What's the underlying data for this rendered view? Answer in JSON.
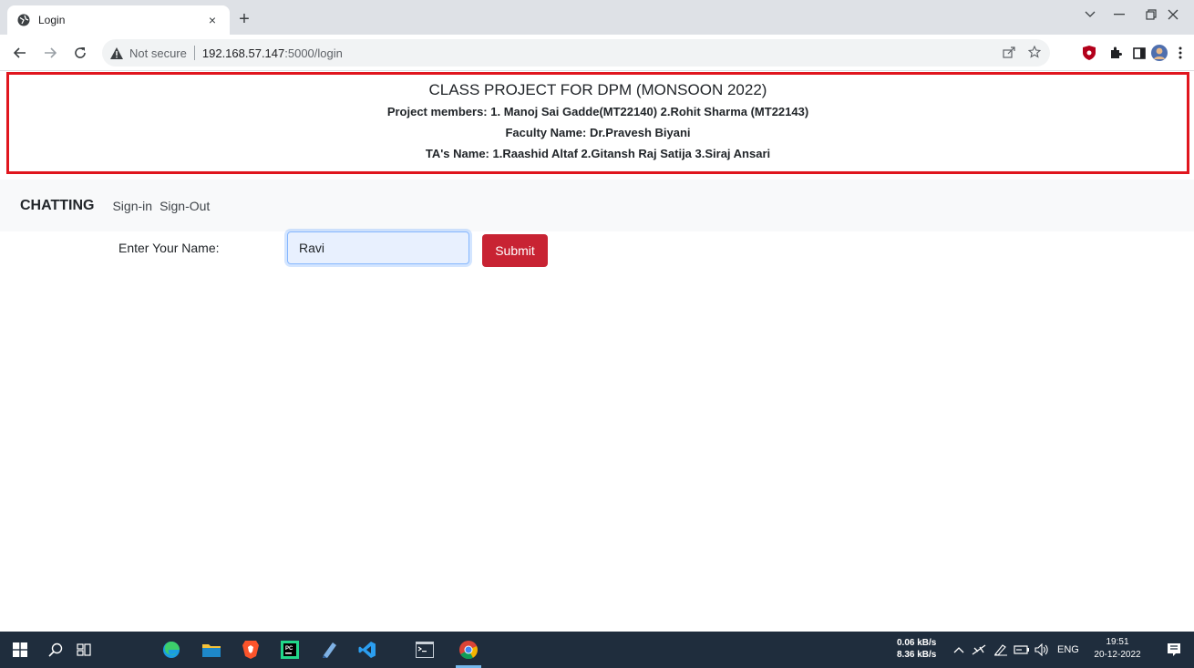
{
  "browser": {
    "tab_title": "Login",
    "tab_close": "×",
    "new_tab": "+",
    "security_label": "Not secure",
    "url_host": "192.168.57.147",
    "url_path": ":5000/login"
  },
  "banner": {
    "title": "CLASS PROJECT FOR DPM (MONSOON 2022)",
    "members": "Project members: 1. Manoj Sai Gadde(MT22140) 2.Rohit Sharma (MT22143)",
    "faculty": "Faculty Name: Dr.Pravesh Biyani",
    "tas": "TA's Name: 1.Raashid Altaf 2.Gitansh Raj Satija 3.Siraj Ansari"
  },
  "navbar": {
    "brand": "CHATTING",
    "links": [
      "Sign-in",
      "Sign-Out"
    ]
  },
  "form": {
    "label": "Enter Your Name:",
    "input_value": "Ravi",
    "submit_label": "Submit"
  },
  "taskbar": {
    "net_up": "0.06 kB/s",
    "net_down": "8.36 kB/s",
    "language": "ENG",
    "time": "19:51",
    "date": "20-12-2022"
  },
  "colors": {
    "banner_border": "#e0161e",
    "submit_bg": "#c82333",
    "taskbar_bg": "#1f2d3d"
  }
}
